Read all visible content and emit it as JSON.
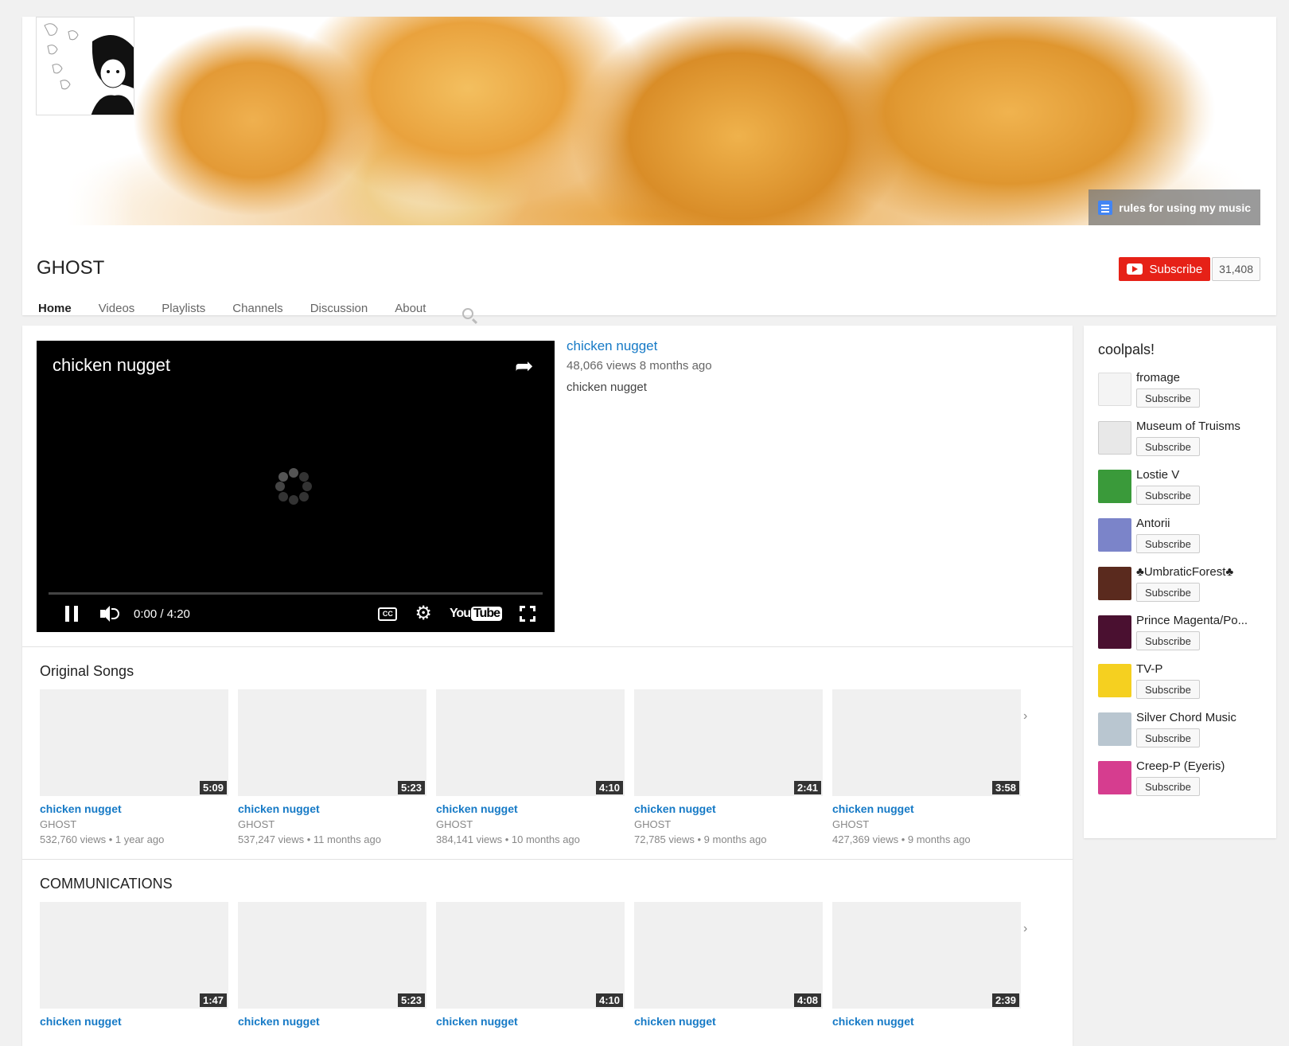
{
  "channel": {
    "name": "GHOST",
    "banner_link": "rules for using my music",
    "subscribe_label": "Subscribe",
    "subscriber_count": "31,408"
  },
  "tabs": [
    {
      "label": "Home",
      "active": true
    },
    {
      "label": "Videos"
    },
    {
      "label": "Playlists"
    },
    {
      "label": "Channels"
    },
    {
      "label": "Discussion"
    },
    {
      "label": "About"
    }
  ],
  "featured": {
    "player_title": "chicken nugget",
    "time": "0:00 / 4:20",
    "cc": "CC",
    "logo_you": "You",
    "logo_tube": "Tube",
    "title": "chicken nugget",
    "meta": "48,066 views  8 months ago",
    "description": "chicken nugget"
  },
  "shelves": [
    {
      "title": "Original Songs",
      "items": [
        {
          "title": "chicken nugget",
          "owner": "GHOST",
          "meta": "532,760 views  •  1 year ago",
          "duration": "5:09"
        },
        {
          "title": "chicken nugget",
          "owner": "GHOST",
          "meta": "537,247 views  •  11 months ago",
          "duration": "5:23"
        },
        {
          "title": "chicken nugget",
          "owner": "GHOST",
          "meta": "384,141 views  •  10 months ago",
          "duration": "4:10"
        },
        {
          "title": "chicken nugget",
          "owner": "GHOST",
          "meta": "72,785 views  •  9 months ago",
          "duration": "2:41"
        },
        {
          "title": "chicken nugget",
          "owner": "GHOST",
          "meta": "427,369 views  •  9 months ago",
          "duration": "3:58"
        }
      ]
    },
    {
      "title": "COMMUNICATIONS",
      "items": [
        {
          "title": "chicken nugget",
          "duration": "1:47"
        },
        {
          "title": "chicken nugget",
          "duration": "5:23"
        },
        {
          "title": "chicken nugget",
          "duration": "4:10"
        },
        {
          "title": "chicken nugget",
          "duration": "4:08"
        },
        {
          "title": "chicken nugget",
          "duration": "2:39"
        }
      ]
    }
  ],
  "sidebar": {
    "title": "coolpals!",
    "subscribe_label": "Subscribe",
    "channels": [
      {
        "name": "fromage",
        "color": "#f4f4f4"
      },
      {
        "name": "Museum of Truisms",
        "color": "#e8e8e8"
      },
      {
        "name": "Lostie V",
        "color": "#3a9a3a"
      },
      {
        "name": "Antorii",
        "color": "#7b84c9"
      },
      {
        "name": "♣UmbraticForest♣",
        "color": "#5a2a1e"
      },
      {
        "name": "Prince Magenta/Po...",
        "color": "#4a1030"
      },
      {
        "name": "TV-P",
        "color": "#f5d020"
      },
      {
        "name": "Silver Chord Music",
        "color": "#b9c6d0"
      },
      {
        "name": "Creep-P (Eyeris)",
        "color": "#d63d8f"
      }
    ]
  }
}
